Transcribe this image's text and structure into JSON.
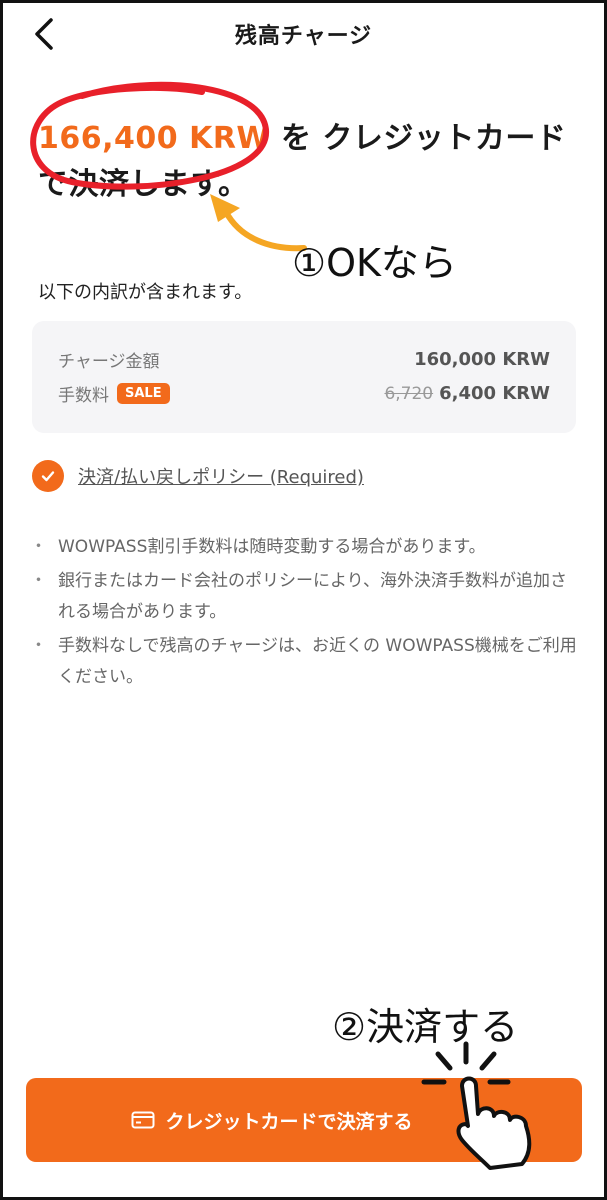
{
  "header": {
    "title": "残高チャージ",
    "back_icon": "chevron-left-icon"
  },
  "headline": {
    "amount": "166,400 KRW",
    "text_after_amount": " を クレジットカード",
    "text_line2": "で決済します。"
  },
  "annotations": {
    "first": "①OKなら",
    "second": "②決済する"
  },
  "breakdown": {
    "intro": "以下の内訳が含まれます。",
    "charge_label": "チャージ金額",
    "charge_value": "160,000 KRW",
    "fee_label": "手数料",
    "fee_badge": "SALE",
    "fee_original": "6,720",
    "fee_value": "6,400 KRW"
  },
  "policy": {
    "label": "決済/払い戻しポリシー (Required)",
    "checked": true
  },
  "notes": [
    "WOWPASS割引手数料は随時変動する場合があります。",
    "銀行またはカード会社のポリシーにより、海外決済手数料が追加される場合があります。",
    "手数料なしで残高のチャージは、お近くの WOWPASS機械をご利用ください。"
  ],
  "pay_button": {
    "label": "クレジットカードで決済する",
    "icon": "credit-card-icon"
  },
  "colors": {
    "accent": "#f26a1b",
    "annotation_red": "#e8202a"
  }
}
